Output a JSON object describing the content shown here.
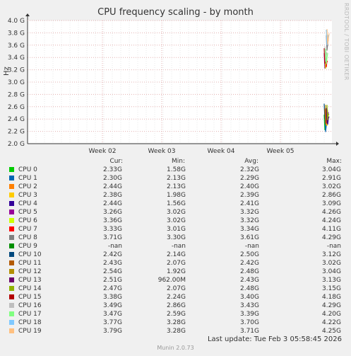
{
  "chart_data": {
    "type": "line",
    "title": "CPU frequency scaling - by month",
    "ylabel": "Hz",
    "watermark": "RRDTOOL / TOBI OETIKER",
    "y_ticks": [
      "2.0 G",
      "2.2 G",
      "2.4 G",
      "2.6 G",
      "2.8 G",
      "3.0 G",
      "3.2 G",
      "3.4 G",
      "3.6 G",
      "3.8 G",
      "4.0 G"
    ],
    "ylim": [
      2.0,
      4.0
    ],
    "x_ticks": [
      "Week 02",
      "Week 03",
      "Week 04",
      "Week 05"
    ],
    "grid": true,
    "legend_headers": [
      "Cur:",
      "Min:",
      "Avg:",
      "Max:"
    ],
    "series": [
      {
        "name": "CPU  0",
        "color": "#00cc00",
        "cur": "2.33G",
        "min": "1.58G",
        "avg": "2.32G",
        "max": "3.04G"
      },
      {
        "name": "CPU  1",
        "color": "#0066b3",
        "cur": "2.30G",
        "min": "2.13G",
        "avg": "2.29G",
        "max": "2.91G"
      },
      {
        "name": "CPU  2",
        "color": "#ff8000",
        "cur": "2.44G",
        "min": "2.13G",
        "avg": "2.40G",
        "max": "3.02G"
      },
      {
        "name": "CPU  3",
        "color": "#ffcc00",
        "cur": "2.38G",
        "min": "1.98G",
        "avg": "2.39G",
        "max": "2.86G"
      },
      {
        "name": "CPU  4",
        "color": "#330099",
        "cur": "2.44G",
        "min": "1.56G",
        "avg": "2.41G",
        "max": "3.09G"
      },
      {
        "name": "CPU  5",
        "color": "#990099",
        "cur": "3.26G",
        "min": "3.02G",
        "avg": "3.32G",
        "max": "4.26G"
      },
      {
        "name": "CPU  6",
        "color": "#ccff00",
        "cur": "3.36G",
        "min": "3.02G",
        "avg": "3.32G",
        "max": "4.24G"
      },
      {
        "name": "CPU  7",
        "color": "#ff0000",
        "cur": "3.33G",
        "min": "3.01G",
        "avg": "3.34G",
        "max": "4.11G"
      },
      {
        "name": "CPU  8",
        "color": "#808080",
        "cur": "3.71G",
        "min": "3.30G",
        "avg": "3.61G",
        "max": "4.29G"
      },
      {
        "name": "CPU  9",
        "color": "#008f00",
        "cur": "-nan",
        "min": "-nan",
        "avg": "-nan",
        "max": "-nan"
      },
      {
        "name": "CPU 10",
        "color": "#00487d",
        "cur": "2.42G",
        "min": "2.14G",
        "avg": "2.50G",
        "max": "3.12G"
      },
      {
        "name": "CPU 11",
        "color": "#b35a00",
        "cur": "2.43G",
        "min": "2.07G",
        "avg": "2.42G",
        "max": "3.02G"
      },
      {
        "name": "CPU 12",
        "color": "#b38f00",
        "cur": "2.54G",
        "min": "1.92G",
        "avg": "2.48G",
        "max": "3.04G"
      },
      {
        "name": "CPU 13",
        "color": "#6b006b",
        "cur": "2.51G",
        "min": "962.00M",
        "avg": "2.43G",
        "max": "3.13G"
      },
      {
        "name": "CPU 14",
        "color": "#8fb300",
        "cur": "2.47G",
        "min": "2.07G",
        "avg": "2.48G",
        "max": "3.15G"
      },
      {
        "name": "CPU 15",
        "color": "#b30000",
        "cur": "3.38G",
        "min": "2.24G",
        "avg": "3.40G",
        "max": "4.18G"
      },
      {
        "name": "CPU 16",
        "color": "#bebebe",
        "cur": "3.49G",
        "min": "2.86G",
        "avg": "3.43G",
        "max": "4.29G"
      },
      {
        "name": "CPU 17",
        "color": "#80ff80",
        "cur": "3.47G",
        "min": "2.59G",
        "avg": "3.39G",
        "max": "4.20G"
      },
      {
        "name": "CPU 18",
        "color": "#80c9ff",
        "cur": "3.77G",
        "min": "3.28G",
        "avg": "3.70G",
        "max": "4.22G"
      },
      {
        "name": "CPU 19",
        "color": "#ffc080",
        "cur": "3.79G",
        "min": "3.28G",
        "avg": "3.71G",
        "max": "4.25G"
      }
    ]
  },
  "footer": {
    "last_update": "Last update: Tue Feb  3 05:58:45 2026",
    "brand": "Munin 2.0.73"
  }
}
